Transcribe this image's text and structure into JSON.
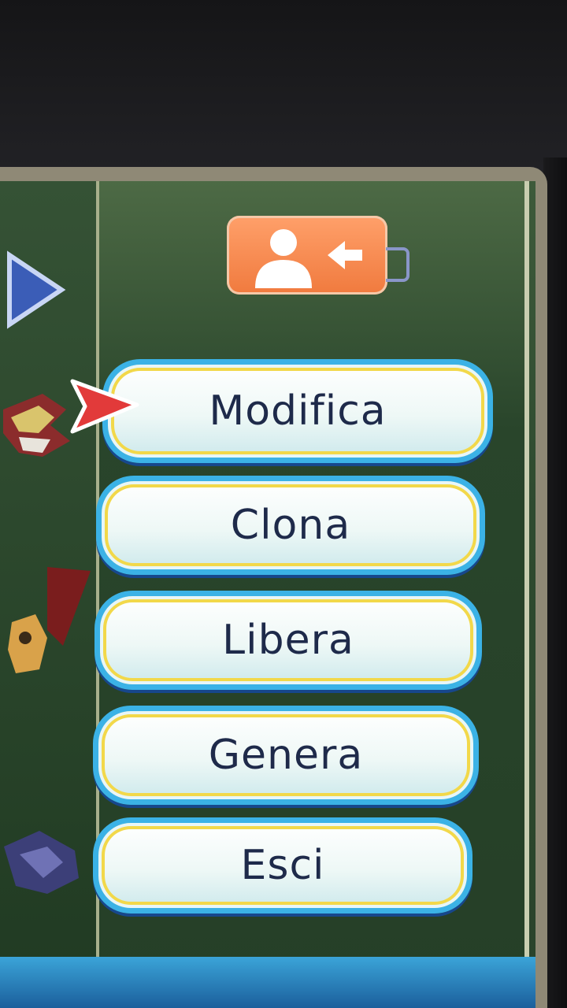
{
  "header": {
    "profile_button": {
      "icon": "user-back-icon",
      "color": "#f58a4f"
    }
  },
  "menu": {
    "items": [
      {
        "label": "Modifica"
      },
      {
        "label": "Clona"
      },
      {
        "label": "Libera"
      },
      {
        "label": "Genera"
      },
      {
        "label": "Esci"
      }
    ],
    "selected_index": 0
  },
  "colors": {
    "button_border": "#3bb2e6",
    "button_inner_accent": "#f2d84a",
    "cursor": "#e23a3a",
    "nav_arrow": "#3b5db7"
  }
}
